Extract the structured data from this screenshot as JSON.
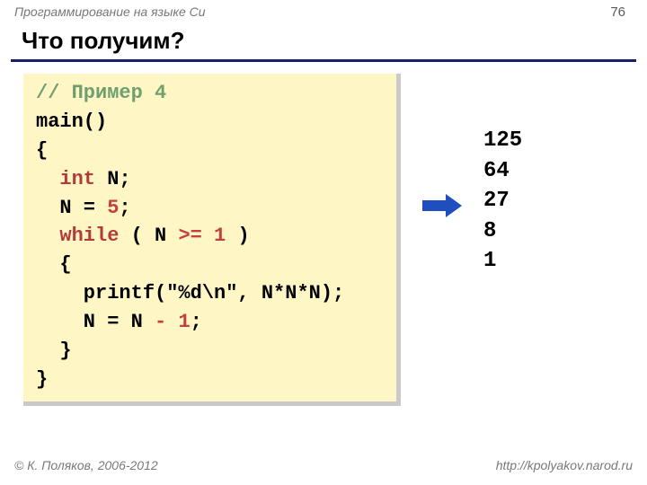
{
  "meta": {
    "course": "Программирование на языке Си",
    "page": "76",
    "title": "Что получим?",
    "footer_left": "© К. Поляков, 2006-2012",
    "footer_right": "http://kpolyakov.narod.ru"
  },
  "code": {
    "comment": "// Пример 4",
    "fn": "main()",
    "brace_open": "{",
    "decl_kw": "int",
    "decl_rest": " N;",
    "assign_lhs": "  N = ",
    "assign_val": "5",
    "assign_end": ";",
    "while_kw": "while",
    "while_open": " ( N ",
    "while_op": ">=",
    "while_sp": " ",
    "while_val": "1",
    "while_close": " )",
    "inner_open": "  {",
    "printf_call": "    printf(\"%d\\n\", N*N*N);",
    "step_lhs": "    N = N ",
    "step_op": "-",
    "step_sp": " ",
    "step_val": "1",
    "step_end": ";",
    "inner_close": "  }",
    "brace_close": "}"
  },
  "output": {
    "l1": "125",
    "l2": "64",
    "l3": "27",
    "l4": "8",
    "l5": "1"
  }
}
